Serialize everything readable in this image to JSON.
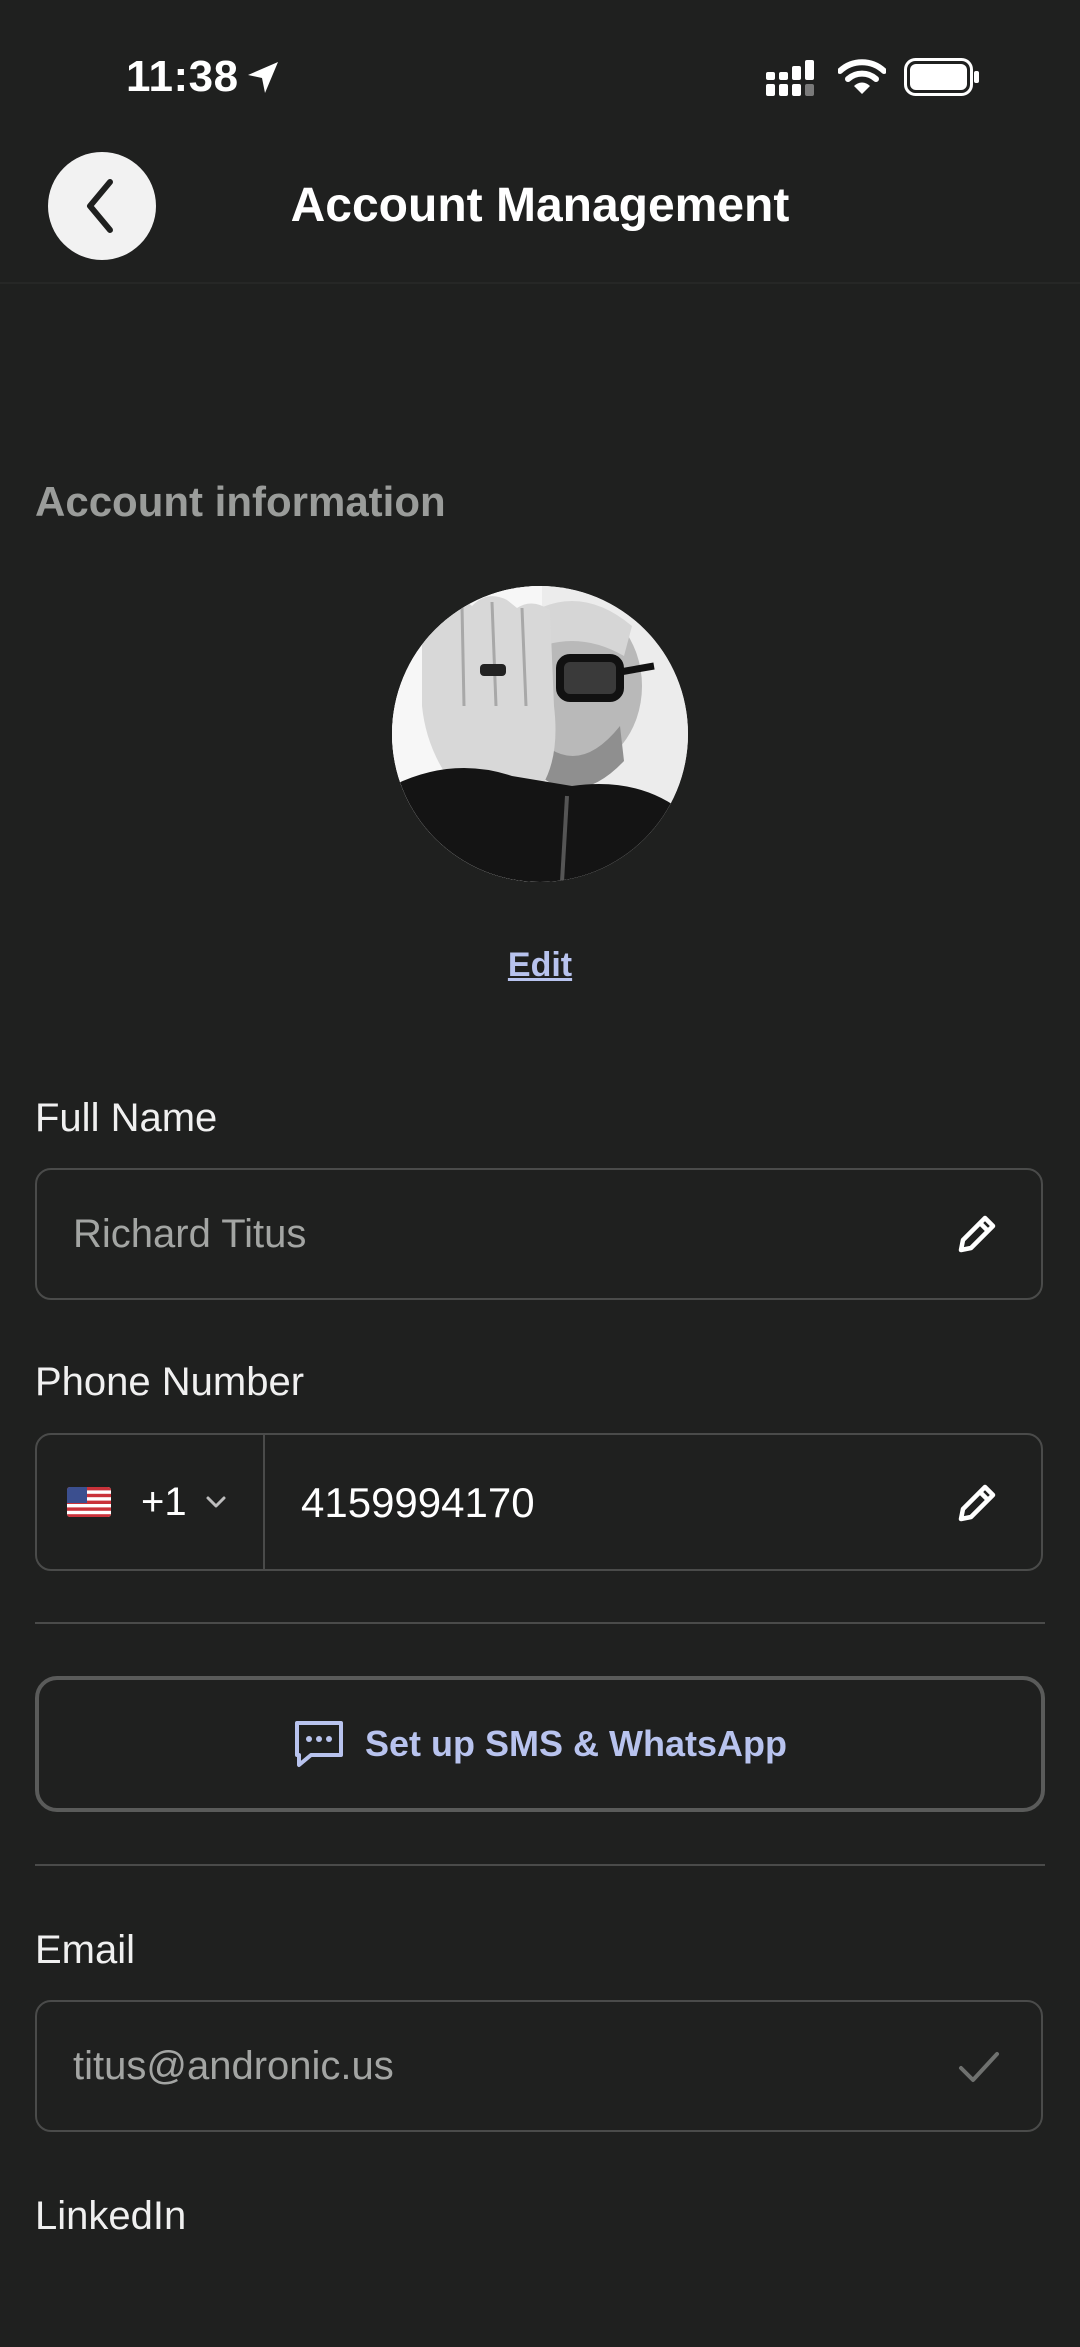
{
  "status_bar": {
    "time": "11:38",
    "icons": [
      "location-arrow-icon",
      "cellular-signal-icon",
      "wifi-icon",
      "battery-icon"
    ]
  },
  "header": {
    "title": "Account Management",
    "back_icon": "chevron-left-icon"
  },
  "account": {
    "section_heading": "Account information",
    "edit_label": "Edit"
  },
  "full_name": {
    "label": "Full Name",
    "value": "Richard Titus",
    "icon": "pencil-icon"
  },
  "phone": {
    "label": "Phone Number",
    "flag_icon": "us-flag-icon",
    "country_code": "+1",
    "value": "4159994170",
    "icon": "pencil-icon"
  },
  "sms": {
    "label": "Set up SMS & WhatsApp",
    "icon": "message-bubble-icon"
  },
  "email": {
    "label": "Email",
    "value": "titus@andronic.us",
    "icon": "checkmark-icon"
  },
  "linkedin": {
    "label": "LinkedIn"
  },
  "colors": {
    "background": "#1f201f",
    "accent": "#b8c3ee",
    "muted_text": "#9a9c9a",
    "border": "#4a4b4a"
  }
}
